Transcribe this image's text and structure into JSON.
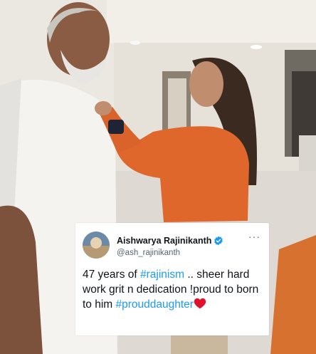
{
  "tweet": {
    "display_name": "Aishwarya Rajinikanth",
    "handle": "@ash_rajinikanth",
    "more_glyph": "···",
    "text_part1": "47 years of ",
    "hashtag1": "#rajinism",
    "text_part2": " .. sheer hard work grit n dedication !proud to born to him ",
    "hashtag2": "#prouddaughter",
    "heart_icon": "red-heart-icon",
    "verified_icon": "verified-badge-icon",
    "hashtag_color": "#1d9bf0",
    "verified_color": "#1d9bf0",
    "heart_color": "#e0102f"
  },
  "photo": {
    "description_icon": "photo-background",
    "shirt_color": "#e0672b"
  }
}
